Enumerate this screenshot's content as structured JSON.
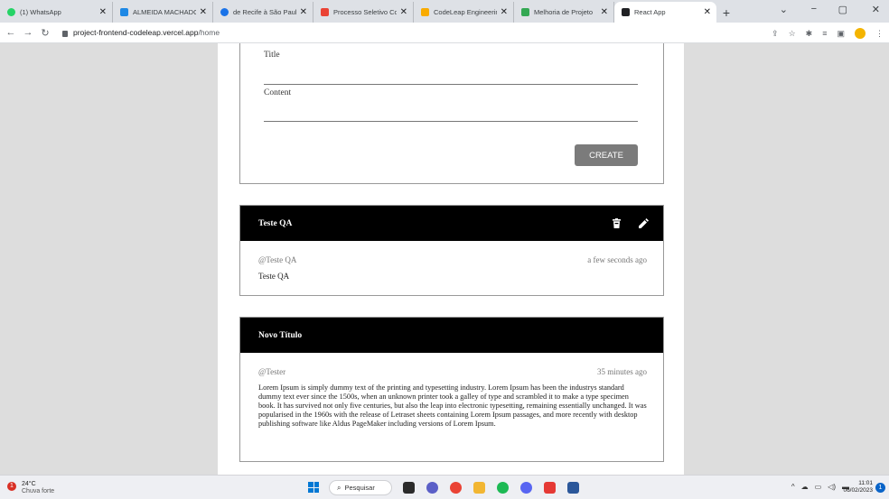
{
  "browser": {
    "tabs": [
      {
        "title": "(1) WhatsApp",
        "fav_color": "#25d366",
        "active": false
      },
      {
        "title": "ALMEIDA MACHADO",
        "fav_color": "#1e88e5",
        "active": false
      },
      {
        "title": "de Recife à São Paulo",
        "fav_color": "#1a73e8",
        "active": false
      },
      {
        "title": "Processo Seletivo Co",
        "fav_color": "#ea4335",
        "active": false
      },
      {
        "title": "CodeLeap Engineerin",
        "fav_color": "#f9ab00",
        "active": false
      },
      {
        "title": "Melhoria de Projeto",
        "fav_color": "#34a853",
        "active": false
      },
      {
        "title": "React App",
        "fav_color": "#202124",
        "active": true
      }
    ],
    "url_host": "project-frontend-codeleap.vercel.app",
    "url_path": "/home"
  },
  "form": {
    "title_label": "Title",
    "content_label": "Content",
    "create_label": "CREATE"
  },
  "posts": [
    {
      "title": "Teste QA",
      "author": "@Teste QA",
      "time": "a few seconds ago",
      "content": "Teste QA"
    },
    {
      "title": "Novo Título",
      "author": "@Tester",
      "time": "35 minutes ago",
      "content": "Lorem Ipsum is simply dummy text of the printing and typesetting industry. Lorem Ipsum has been the industrys standard dummy text ever since the 1500s, when an unknown printer took a galley of type and scrambled it to make a type specimen book. It has survived not only five centuries, but also the leap into electronic typesetting, remaining essentially unchanged. It was popularised in the 1960s with the release of Letraset sheets containing Lorem Ipsum passages, and more recently with desktop publishing software like Aldus PageMaker including versions of Lorem Ipsum."
    }
  ],
  "taskbar": {
    "weather_temp": "24°C",
    "weather_desc": "Chuva forte",
    "weather_badge": "1",
    "search_label": "Pesquisar",
    "time": "11:01",
    "date": "06/02/2023",
    "notif_count": "1"
  },
  "colors": {
    "header_bg": "#000000",
    "button_bg": "#7b7b7b",
    "page_bg": "#dddddd"
  }
}
